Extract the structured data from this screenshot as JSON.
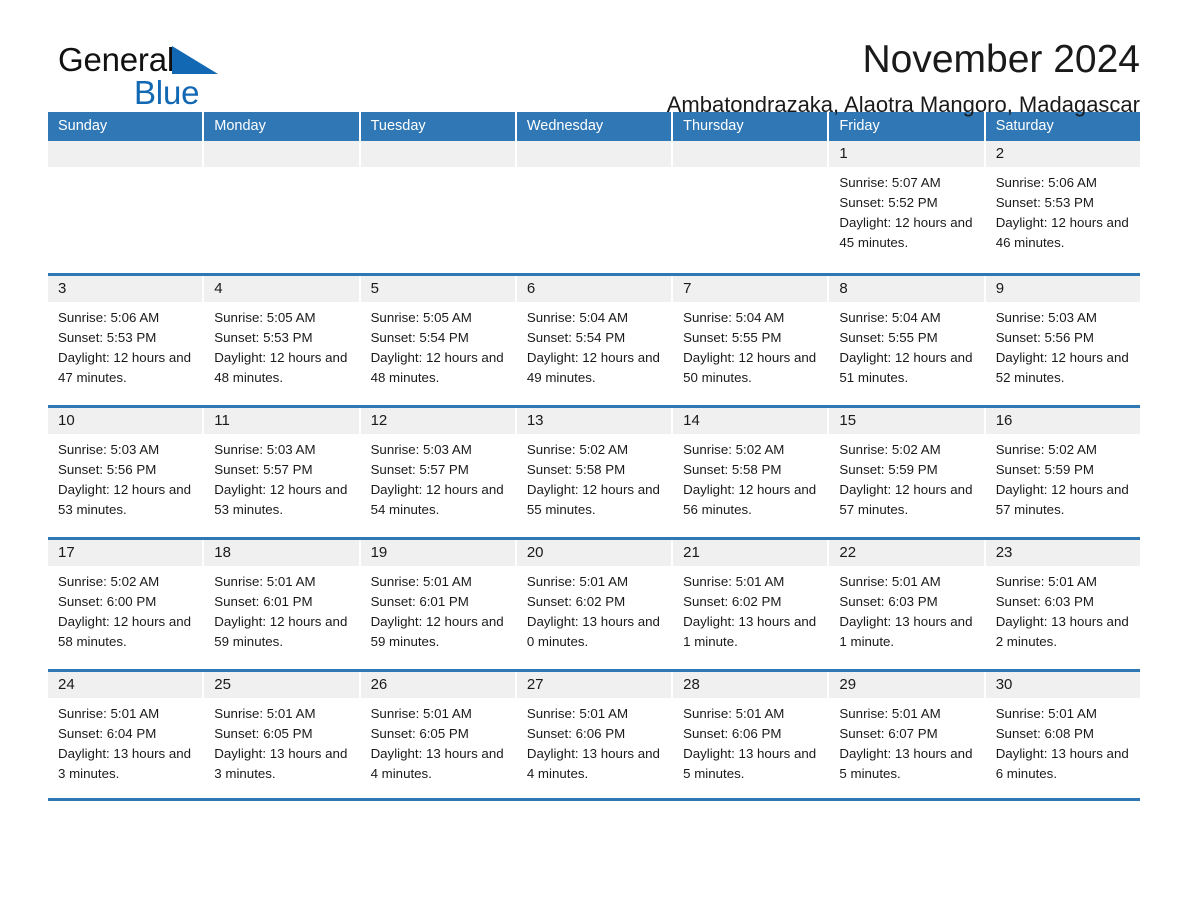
{
  "brand": {
    "name_part1": "General",
    "name_part2": "Blue",
    "triangle_color": "#1268b3",
    "text_color": "#111111"
  },
  "header": {
    "title": "November 2024",
    "location": "Ambatondrazaka, Alaotra Mangoro, Madagascar"
  },
  "theme": {
    "header_blue": "#2f77b5",
    "day_strip_gray": "#f0f0f0",
    "cell_white": "#ffffff"
  },
  "weekdays": [
    "Sunday",
    "Monday",
    "Tuesday",
    "Wednesday",
    "Thursday",
    "Friday",
    "Saturday"
  ],
  "weeks": [
    [
      {
        "num": "",
        "empty": true
      },
      {
        "num": "",
        "empty": true
      },
      {
        "num": "",
        "empty": true
      },
      {
        "num": "",
        "empty": true
      },
      {
        "num": "",
        "empty": true
      },
      {
        "num": "1",
        "sunrise": "Sunrise: 5:07 AM",
        "sunset": "Sunset: 5:52 PM",
        "daylight": "Daylight: 12 hours and 45 minutes."
      },
      {
        "num": "2",
        "sunrise": "Sunrise: 5:06 AM",
        "sunset": "Sunset: 5:53 PM",
        "daylight": "Daylight: 12 hours and 46 minutes."
      }
    ],
    [
      {
        "num": "3",
        "sunrise": "Sunrise: 5:06 AM",
        "sunset": "Sunset: 5:53 PM",
        "daylight": "Daylight: 12 hours and 47 minutes."
      },
      {
        "num": "4",
        "sunrise": "Sunrise: 5:05 AM",
        "sunset": "Sunset: 5:53 PM",
        "daylight": "Daylight: 12 hours and 48 minutes."
      },
      {
        "num": "5",
        "sunrise": "Sunrise: 5:05 AM",
        "sunset": "Sunset: 5:54 PM",
        "daylight": "Daylight: 12 hours and 48 minutes."
      },
      {
        "num": "6",
        "sunrise": "Sunrise: 5:04 AM",
        "sunset": "Sunset: 5:54 PM",
        "daylight": "Daylight: 12 hours and 49 minutes."
      },
      {
        "num": "7",
        "sunrise": "Sunrise: 5:04 AM",
        "sunset": "Sunset: 5:55 PM",
        "daylight": "Daylight: 12 hours and 50 minutes."
      },
      {
        "num": "8",
        "sunrise": "Sunrise: 5:04 AM",
        "sunset": "Sunset: 5:55 PM",
        "daylight": "Daylight: 12 hours and 51 minutes."
      },
      {
        "num": "9",
        "sunrise": "Sunrise: 5:03 AM",
        "sunset": "Sunset: 5:56 PM",
        "daylight": "Daylight: 12 hours and 52 minutes."
      }
    ],
    [
      {
        "num": "10",
        "sunrise": "Sunrise: 5:03 AM",
        "sunset": "Sunset: 5:56 PM",
        "daylight": "Daylight: 12 hours and 53 minutes."
      },
      {
        "num": "11",
        "sunrise": "Sunrise: 5:03 AM",
        "sunset": "Sunset: 5:57 PM",
        "daylight": "Daylight: 12 hours and 53 minutes."
      },
      {
        "num": "12",
        "sunrise": "Sunrise: 5:03 AM",
        "sunset": "Sunset: 5:57 PM",
        "daylight": "Daylight: 12 hours and 54 minutes."
      },
      {
        "num": "13",
        "sunrise": "Sunrise: 5:02 AM",
        "sunset": "Sunset: 5:58 PM",
        "daylight": "Daylight: 12 hours and 55 minutes."
      },
      {
        "num": "14",
        "sunrise": "Sunrise: 5:02 AM",
        "sunset": "Sunset: 5:58 PM",
        "daylight": "Daylight: 12 hours and 56 minutes."
      },
      {
        "num": "15",
        "sunrise": "Sunrise: 5:02 AM",
        "sunset": "Sunset: 5:59 PM",
        "daylight": "Daylight: 12 hours and 57 minutes."
      },
      {
        "num": "16",
        "sunrise": "Sunrise: 5:02 AM",
        "sunset": "Sunset: 5:59 PM",
        "daylight": "Daylight: 12 hours and 57 minutes."
      }
    ],
    [
      {
        "num": "17",
        "sunrise": "Sunrise: 5:02 AM",
        "sunset": "Sunset: 6:00 PM",
        "daylight": "Daylight: 12 hours and 58 minutes."
      },
      {
        "num": "18",
        "sunrise": "Sunrise: 5:01 AM",
        "sunset": "Sunset: 6:01 PM",
        "daylight": "Daylight: 12 hours and 59 minutes."
      },
      {
        "num": "19",
        "sunrise": "Sunrise: 5:01 AM",
        "sunset": "Sunset: 6:01 PM",
        "daylight": "Daylight: 12 hours and 59 minutes."
      },
      {
        "num": "20",
        "sunrise": "Sunrise: 5:01 AM",
        "sunset": "Sunset: 6:02 PM",
        "daylight": "Daylight: 13 hours and 0 minutes."
      },
      {
        "num": "21",
        "sunrise": "Sunrise: 5:01 AM",
        "sunset": "Sunset: 6:02 PM",
        "daylight": "Daylight: 13 hours and 1 minute."
      },
      {
        "num": "22",
        "sunrise": "Sunrise: 5:01 AM",
        "sunset": "Sunset: 6:03 PM",
        "daylight": "Daylight: 13 hours and 1 minute."
      },
      {
        "num": "23",
        "sunrise": "Sunrise: 5:01 AM",
        "sunset": "Sunset: 6:03 PM",
        "daylight": "Daylight: 13 hours and 2 minutes."
      }
    ],
    [
      {
        "num": "24",
        "sunrise": "Sunrise: 5:01 AM",
        "sunset": "Sunset: 6:04 PM",
        "daylight": "Daylight: 13 hours and 3 minutes."
      },
      {
        "num": "25",
        "sunrise": "Sunrise: 5:01 AM",
        "sunset": "Sunset: 6:05 PM",
        "daylight": "Daylight: 13 hours and 3 minutes."
      },
      {
        "num": "26",
        "sunrise": "Sunrise: 5:01 AM",
        "sunset": "Sunset: 6:05 PM",
        "daylight": "Daylight: 13 hours and 4 minutes."
      },
      {
        "num": "27",
        "sunrise": "Sunrise: 5:01 AM",
        "sunset": "Sunset: 6:06 PM",
        "daylight": "Daylight: 13 hours and 4 minutes."
      },
      {
        "num": "28",
        "sunrise": "Sunrise: 5:01 AM",
        "sunset": "Sunset: 6:06 PM",
        "daylight": "Daylight: 13 hours and 5 minutes."
      },
      {
        "num": "29",
        "sunrise": "Sunrise: 5:01 AM",
        "sunset": "Sunset: 6:07 PM",
        "daylight": "Daylight: 13 hours and 5 minutes."
      },
      {
        "num": "30",
        "sunrise": "Sunrise: 5:01 AM",
        "sunset": "Sunset: 6:08 PM",
        "daylight": "Daylight: 13 hours and 6 minutes."
      }
    ]
  ]
}
